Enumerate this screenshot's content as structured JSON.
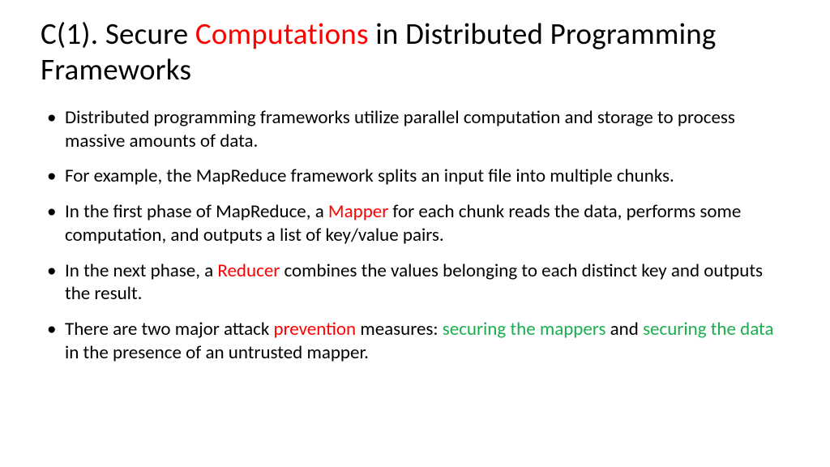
{
  "title": {
    "pre": "C(1). Secure ",
    "hl": "Computations",
    "post": " in Distributed Programming Frameworks"
  },
  "bullets": [
    {
      "parts": [
        {
          "t": "Distributed programming frameworks utilize parallel computation and storage to process massive amounts of data."
        }
      ]
    },
    {
      "parts": [
        {
          "t": "For example, the MapReduce framework splits an input file into multiple chunks."
        }
      ]
    },
    {
      "parts": [
        {
          "t": "In the first phase of MapReduce, a "
        },
        {
          "t": "Mapper",
          "cls": "red"
        },
        {
          "t": " for each chunk reads the data, performs some computation, and outputs a list of key/value pairs."
        }
      ]
    },
    {
      "parts": [
        {
          "t": "In the next phase, a "
        },
        {
          "t": "Reducer",
          "cls": "red"
        },
        {
          "t": " combines the values belonging to each distinct key and outputs the result."
        }
      ]
    },
    {
      "parts": [
        {
          "t": "There are two major attack "
        },
        {
          "t": "prevention",
          "cls": "red"
        },
        {
          "t": " measures: "
        },
        {
          "t": "securing the mappers",
          "cls": "green"
        },
        {
          "t": " and "
        },
        {
          "t": "securing the data",
          "cls": "green"
        },
        {
          "t": " in the presence of an untrusted mapper."
        }
      ]
    }
  ]
}
